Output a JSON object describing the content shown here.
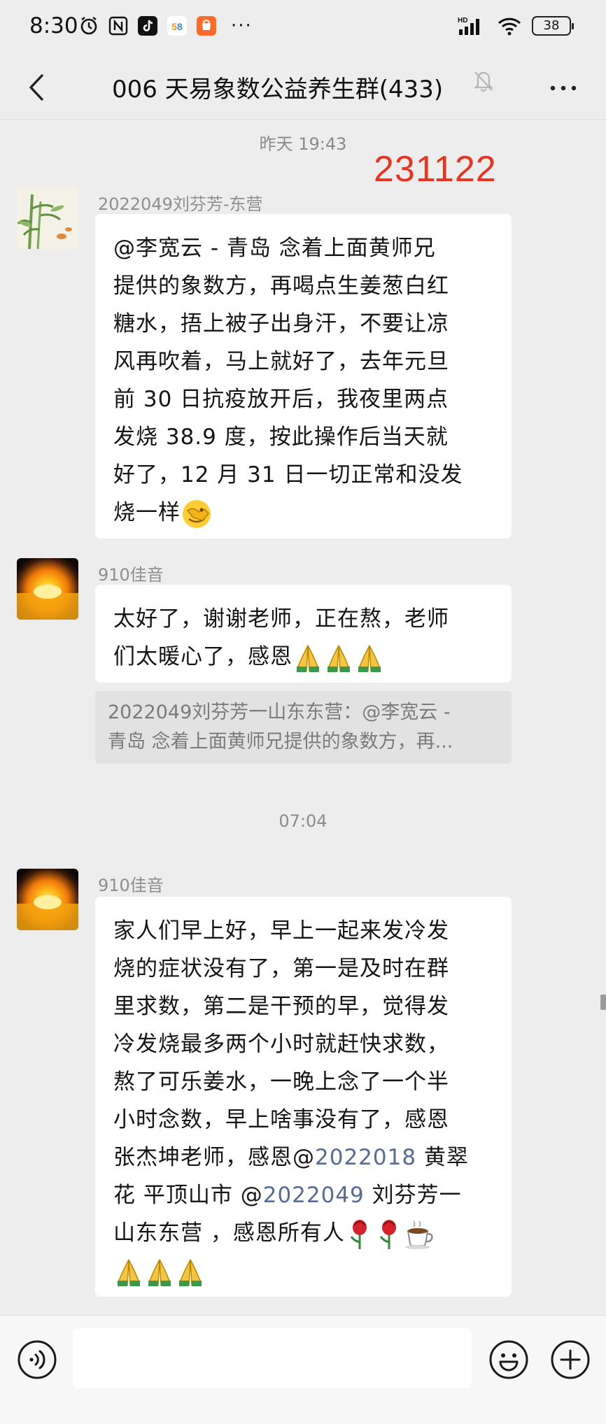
{
  "status_bar": {
    "time": "8:30",
    "notification_icons": [
      "alarm-icon",
      "nfc-icon",
      "tiktok-icon",
      "app-58-icon",
      "taobao-icon"
    ],
    "more_dots": "···",
    "network": "HD",
    "battery": "38"
  },
  "header": {
    "title": "006 天易象数公益养生群(433)"
  },
  "messages_area": {
    "time_1": "昨天 19:43",
    "stamp": "231122",
    "msg1": {
      "sender": "2022049刘芬芳-东营",
      "lines": [
        "@李宽云 - 青岛  念着上面黄师兄",
        "提供的象数方，再喝点生姜葱白红",
        "糖水，捂上被子出身汗，不要让凉",
        "风再吹着，马上就好了，去年元旦",
        "前 30 日抗疫放开后，我夜里两点",
        "发烧 38.9 度，按此操作后当天就",
        "好了，12 月 31 日一切正常和没发",
        "烧一样"
      ]
    },
    "msg2": {
      "sender": "910佳音",
      "lines": [
        "太好了，谢谢老师，正在熬，老师",
        "们太暖心了，感恩"
      ],
      "quote_lines": [
        "2022049刘芬芳一山东东营：@李宽云 -",
        "青岛 念着上面黄师兄提供的象数方，再..."
      ]
    },
    "time_2": "07:04",
    "msg3": {
      "sender": "910佳音",
      "line1": "家人们早上好，早上一起来发冷发",
      "line2": "烧的症状没有了，第一是及时在群",
      "line3": "里求数，第二是干预的早，觉得发",
      "line4": "冷发烧最多两个小时就赶快求数，",
      "line5": "熬了可乐姜水，一晚上念了一个半",
      "line6": "小时念数，早上啥事没有了，感恩",
      "line7a": "张杰坤老师，感恩@",
      "line7_mention": "2022018",
      "line7b": " 黄翠",
      "line8a": "花  平顶山市  @",
      "line8_mention": "2022049",
      "line8b": " 刘芬芳一",
      "line9": "山东东营  ，感恩所有人"
    }
  },
  "colors": {
    "background": "#ededed",
    "bubble": "#ffffff",
    "stamp": "#e8331f",
    "mention": "#576b95"
  }
}
